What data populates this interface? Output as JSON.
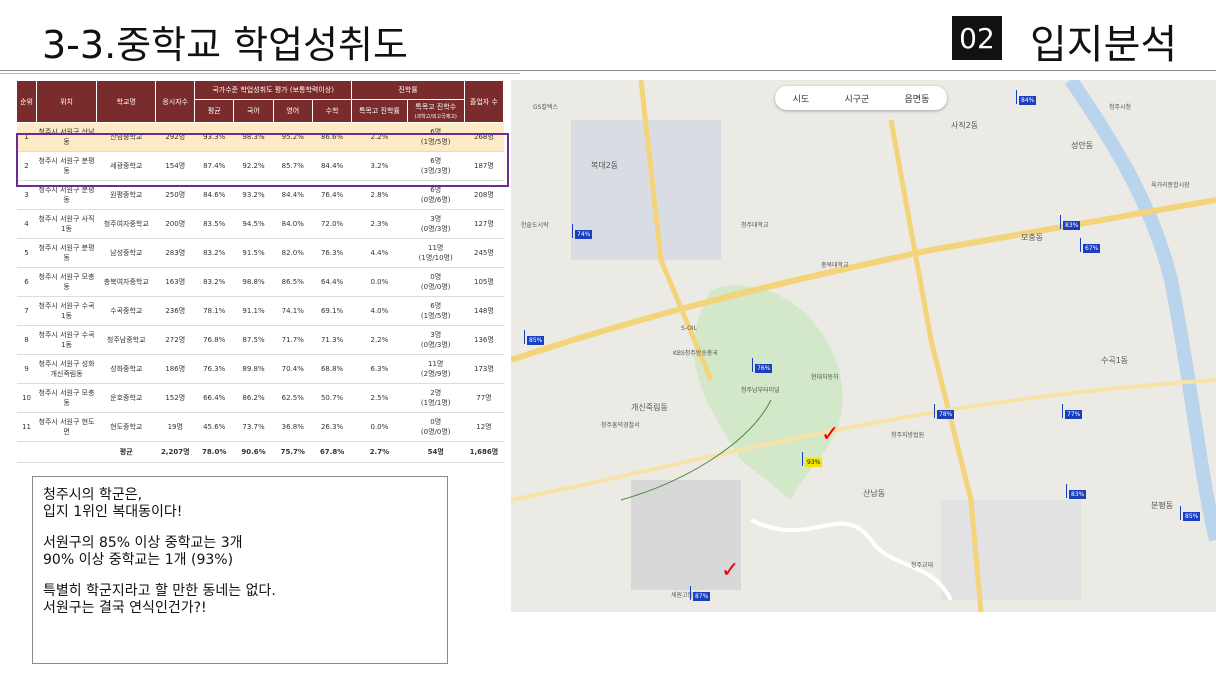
{
  "header": {
    "title": "3-3.중학교 학업성취도",
    "section_number": "02",
    "section_title": "입지분석"
  },
  "table": {
    "headers": {
      "rank": "순위",
      "location": "위치",
      "school": "학교명",
      "takers": "응시자수",
      "group_achievement": "국가수준 학업성취도 평가 (보통학력이상)",
      "avg": "평균",
      "korean": "국어",
      "english": "영어",
      "math": "수학",
      "group_advance": "진학률",
      "special_rate": "특목고 진학률",
      "special_count": "특목고 진학수",
      "special_count_sub": "(과학고/외고국제고)",
      "graduates": "졸업자 수"
    },
    "rows": [
      {
        "rank": "1",
        "location": "청주시 서원구 산남동",
        "school": "산남중학교",
        "takers": "292명",
        "avg": "93.3%",
        "korean": "98.3%",
        "english": "95.2%",
        "math": "86.6%",
        "special_rate": "2.2%",
        "special_count": "6명",
        "special_detail": "(1명/5명)",
        "graduates": "268명"
      },
      {
        "rank": "2",
        "location": "청주시 서원구 분평동",
        "school": "세광중학교",
        "takers": "154명",
        "avg": "87.4%",
        "korean": "92.2%",
        "english": "85.7%",
        "math": "84.4%",
        "special_rate": "3.2%",
        "special_count": "6명",
        "special_detail": "(3명/3명)",
        "graduates": "187명"
      },
      {
        "rank": "3",
        "location": "청주시 서원구 분평동",
        "school": "원평중학교",
        "takers": "250명",
        "avg": "84.6%",
        "korean": "93.2%",
        "english": "84.4%",
        "math": "76.4%",
        "special_rate": "2.8%",
        "special_count": "6명",
        "special_detail": "(0명/6명)",
        "graduates": "208명"
      },
      {
        "rank": "4",
        "location": "청주시 서원구 사직1동",
        "school": "청주여자중학교",
        "takers": "200명",
        "avg": "83.5%",
        "korean": "94.5%",
        "english": "84.0%",
        "math": "72.0%",
        "special_rate": "2.3%",
        "special_count": "3명",
        "special_detail": "(0명/3명)",
        "graduates": "127명"
      },
      {
        "rank": "5",
        "location": "청주시 서원구 분평동",
        "school": "남성중학교",
        "takers": "283명",
        "avg": "83.2%",
        "korean": "91.5%",
        "english": "82.0%",
        "math": "76.3%",
        "special_rate": "4.4%",
        "special_count": "11명",
        "special_detail": "(1명/10명)",
        "graduates": "245명"
      },
      {
        "rank": "6",
        "location": "청주시 서원구 모충동",
        "school": "충북여자중학교",
        "takers": "163명",
        "avg": "83.2%",
        "korean": "98.8%",
        "english": "86.5%",
        "math": "64.4%",
        "special_rate": "0.0%",
        "special_count": "0명",
        "special_detail": "(0명/0명)",
        "graduates": "105명"
      },
      {
        "rank": "7",
        "location": "청주시 서원구 수곡1동",
        "school": "수곡중학교",
        "takers": "236명",
        "avg": "78.1%",
        "korean": "91.1%",
        "english": "74.1%",
        "math": "69.1%",
        "special_rate": "4.0%",
        "special_count": "6명",
        "special_detail": "(1명/5명)",
        "graduates": "148명"
      },
      {
        "rank": "8",
        "location": "청주시 서원구 수곡1동",
        "school": "청주남중학교",
        "takers": "272명",
        "avg": "76.8%",
        "korean": "87.5%",
        "english": "71.7%",
        "math": "71.3%",
        "special_rate": "2.2%",
        "special_count": "3명",
        "special_detail": "(0명/3명)",
        "graduates": "136명"
      },
      {
        "rank": "9",
        "location": "청주시 서원구 성화개신죽림동",
        "school": "성화중학교",
        "takers": "186명",
        "avg": "76.3%",
        "korean": "89.8%",
        "english": "70.4%",
        "math": "68.8%",
        "special_rate": "6.3%",
        "special_count": "11명",
        "special_detail": "(2명/9명)",
        "graduates": "173명"
      },
      {
        "rank": "10",
        "location": "청주시 서원구 모충동",
        "school": "운호중학교",
        "takers": "152명",
        "avg": "66.4%",
        "korean": "86.2%",
        "english": "62.5%",
        "math": "50.7%",
        "special_rate": "2.5%",
        "special_count": "2명",
        "special_detail": "(1명/1명)",
        "graduates": "77명"
      },
      {
        "rank": "11",
        "location": "청주시 서원구 현도면",
        "school": "현도중학교",
        "takers": "19명",
        "avg": "45.6%",
        "korean": "73.7%",
        "english": "36.8%",
        "math": "26.3%",
        "special_rate": "0.0%",
        "special_count": "0명",
        "special_detail": "(0명/0명)",
        "graduates": "12명"
      }
    ],
    "average": {
      "label": "평균",
      "takers": "2,207명",
      "avg": "78.0%",
      "korean": "90.6%",
      "english": "75.7%",
      "math": "67.8%",
      "special_rate": "2.7%",
      "special_count": "54명",
      "graduates": "1,686명"
    }
  },
  "note": {
    "line1": "청주시의 학군은,\n입지 1위인 복대동이다!",
    "line2": "서원구의 85% 이상 중학교는 3개\n90% 이상 중학교는 1개 (93%)",
    "line3": "특별히 학군지라고 할 만한 동네는 없다.\n서원구는 결국 연식인건가?!"
  },
  "map": {
    "controls": [
      "시도",
      "시구군",
      "읍면동"
    ],
    "labels": [
      "사직2동",
      "복대2동",
      "성안동",
      "모충동",
      "수곡1동",
      "산남동",
      "분평동",
      "개신죽림동",
      "충북대학교",
      "청주시청",
      "육거리종합시장",
      "현대자동차",
      "한솥도시락",
      "청주흥덕경찰서",
      "청주지방법원",
      "청주교대",
      "청주대학교",
      "세원고등학교",
      "GS칼텍스",
      "S-OIL",
      "청주남부터미널",
      "KBS청주방송총국"
    ],
    "markers": [
      {
        "label": "84%",
        "sub": "청주여자중",
        "color": "blue"
      },
      {
        "label": "74%",
        "sub": "가경중",
        "color": "blue"
      },
      {
        "label": "83%",
        "sub": "충북여자중",
        "color": "blue"
      },
      {
        "label": "67%",
        "sub": "운호중",
        "color": "blue"
      },
      {
        "label": "85%",
        "sub": "서경중",
        "color": "blue"
      },
      {
        "label": "76%",
        "sub": "성화중",
        "color": "blue"
      },
      {
        "label": "78%",
        "sub": "수곡중",
        "color": "blue"
      },
      {
        "label": "77%",
        "sub": "청주남중",
        "color": "blue"
      },
      {
        "label": "93%",
        "sub": "산남중",
        "color": "yellow"
      },
      {
        "label": "83%",
        "sub": "남성중",
        "color": "blue"
      },
      {
        "label": "85%",
        "sub": "원평중",
        "color": "blue"
      },
      {
        "label": "87%",
        "sub": "세광중",
        "color": "blue"
      }
    ]
  }
}
